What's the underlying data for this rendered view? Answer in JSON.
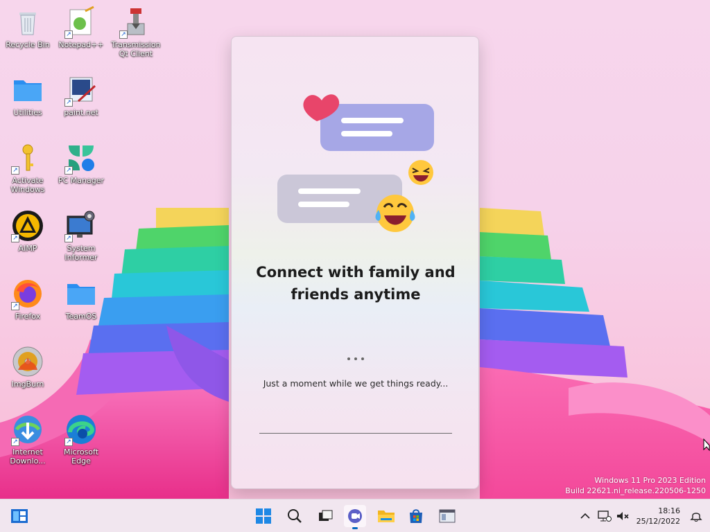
{
  "desktop": {
    "icons": [
      {
        "label": "Recycle Bin"
      },
      {
        "label": "Notepad++"
      },
      {
        "label": "Transmission Qt Client"
      },
      {
        "label": "Utilities"
      },
      {
        "label": "paint.net"
      },
      {
        "label": "Activate Windows"
      },
      {
        "label": "PC Manager"
      },
      {
        "label": "AIMP"
      },
      {
        "label": "System Informer"
      },
      {
        "label": "Firefox"
      },
      {
        "label": "TeamOS"
      },
      {
        "label": "ImgBurn"
      },
      {
        "label": "Internet Downlo..."
      },
      {
        "label": "Microsoft Edge"
      }
    ]
  },
  "dialog": {
    "title_line1": "Connect with family and",
    "title_line2": "friends anytime",
    "message": "Just a moment while we get things ready..."
  },
  "watermark": {
    "line1": "Windows 11 Pro 2023 Edition",
    "line2": "Build 22621.ni_release.220506-1250"
  },
  "taskbar": {
    "items": [
      "widgets-icon",
      "start-icon",
      "search-icon",
      "task-view-icon",
      "teams-chat-icon",
      "file-explorer-icon",
      "store-icon",
      "app-window-icon"
    ],
    "active": "teams-chat-icon",
    "tray": {
      "time": "18:16",
      "date": "25/12/2022"
    }
  },
  "colors": {
    "accent": "#0067c0",
    "title_text": "#1b1b1b",
    "bubble_purple": "#9b9ae0",
    "bubble_gray": "#c9c6d6",
    "heart": "#e8456a"
  }
}
